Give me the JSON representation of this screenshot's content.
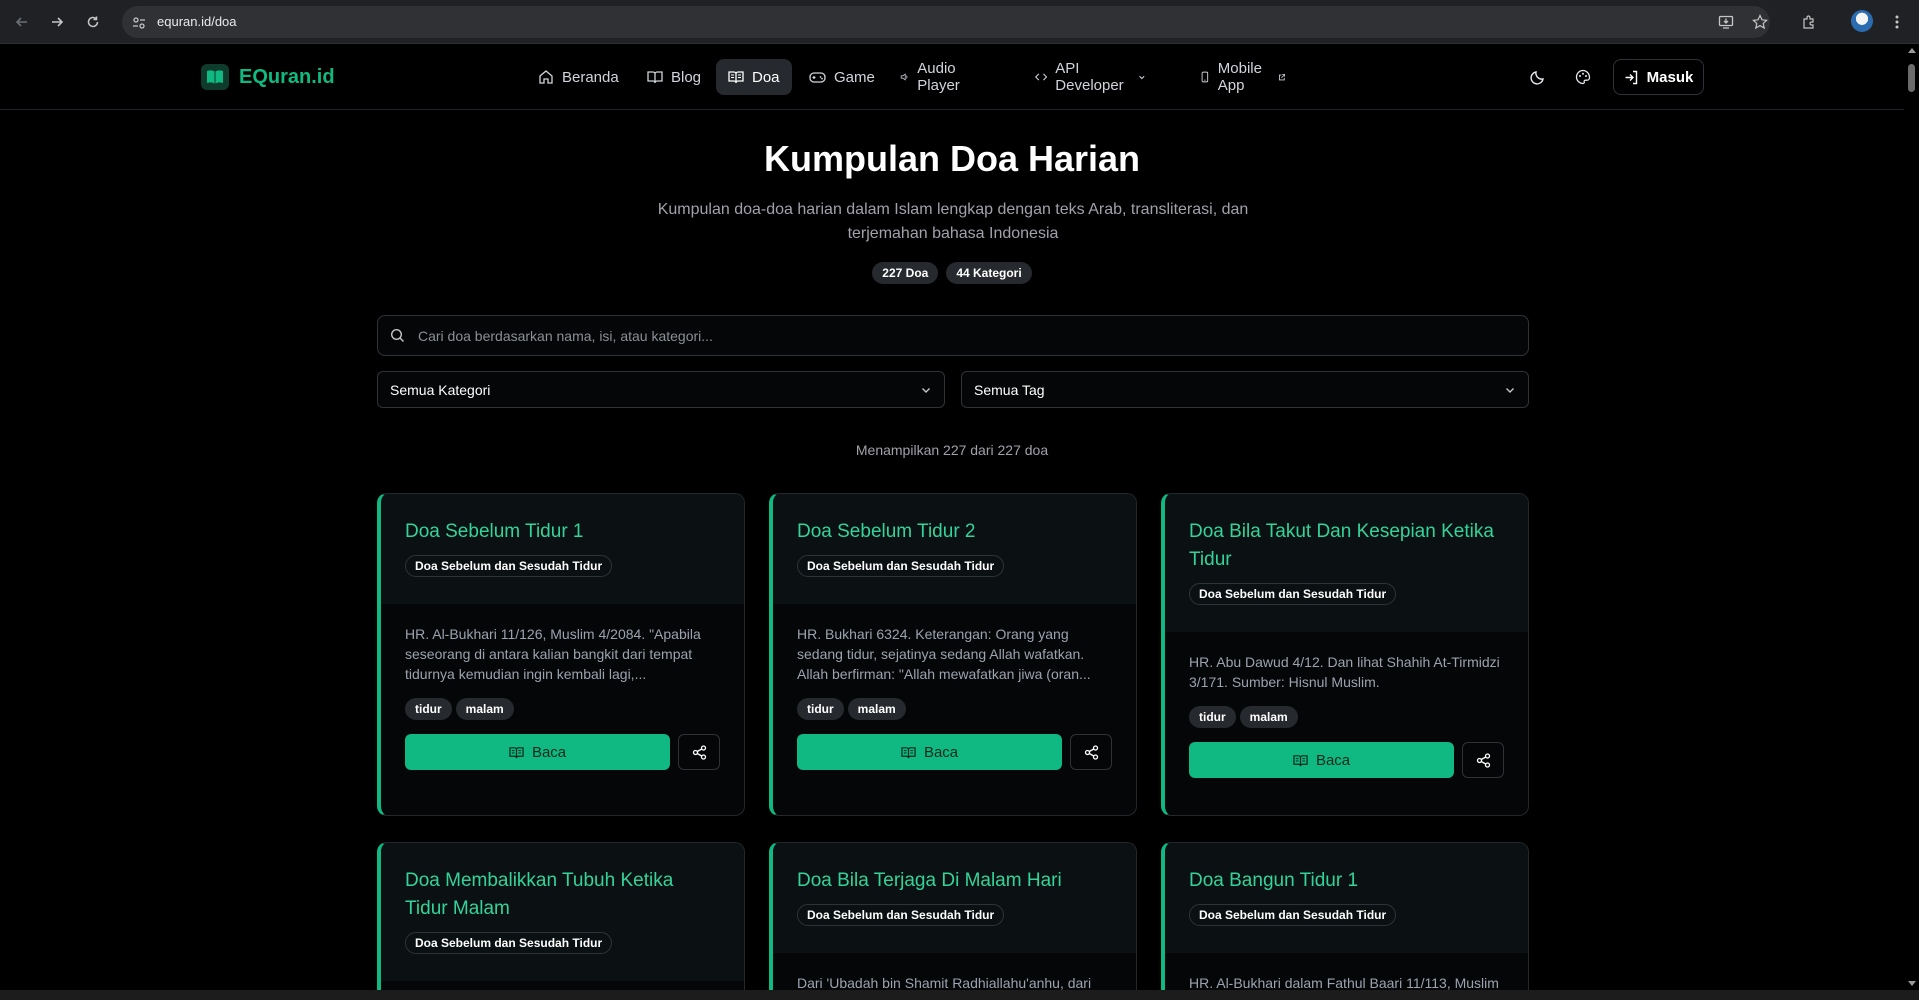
{
  "browser": {
    "url": "equran.id/doa"
  },
  "site": {
    "logo_text": "EQuran.id",
    "accent": "#10b981",
    "nav": [
      {
        "label": "Beranda",
        "icon": "home-icon"
      },
      {
        "label": "Blog",
        "icon": "book-open-icon"
      },
      {
        "label": "Doa",
        "icon": "book-open-icon"
      },
      {
        "label": "Game",
        "icon": "gamepad-icon"
      },
      {
        "label": "Audio Player",
        "icon": "speaker-icon"
      },
      {
        "label": "API Developer",
        "icon": "code-icon"
      },
      {
        "label": "Mobile App",
        "icon": "smartphone-icon"
      }
    ],
    "active_nav": "Doa",
    "login_label": "Masuk"
  },
  "hero": {
    "title": "Kumpulan Doa Harian",
    "subtitle": "Kumpulan doa-doa harian dalam Islam lengkap dengan teks Arab, transliterasi, dan terjemahan bahasa Indonesia",
    "stats": [
      "227 Doa",
      "44 Kategori"
    ]
  },
  "search": {
    "placeholder": "Cari doa berdasarkan nama, isi, atau kategori..."
  },
  "filters": {
    "category": "Semua Kategori",
    "tag": "Semua Tag"
  },
  "result_count": "Menampilkan 227 dari 227 doa",
  "card_labels": {
    "read": "Baca"
  },
  "cards": [
    {
      "title": "Doa Sebelum Tidur 1",
      "category": "Doa Sebelum dan Sesudah Tidur",
      "desc": "HR. Al-Bukhari 11/126, Muslim 4/2084. \"Apabila seseorang di antara kalian bangkit dari tempat tidurnya kemudian ingin kembali lagi,...",
      "tags": [
        "tidur",
        "malam"
      ]
    },
    {
      "title": "Doa Sebelum Tidur 2",
      "category": "Doa Sebelum dan Sesudah Tidur",
      "desc": "HR. Bukhari 6324. Keterangan: Orang yang sedang tidur, sejatinya sedang Allah wafatkan. Allah berfirman: \"Allah mewafatkan jiwa (oran...",
      "tags": [
        "tidur",
        "malam"
      ]
    },
    {
      "title": "Doa Bila Takut Dan Kesepian Ketika Tidur",
      "category": "Doa Sebelum dan Sesudah Tidur",
      "desc": "HR. Abu Dawud 4/12. Dan lihat Shahih At-Tirmidzi 3/171. Sumber: Hisnul Muslim.",
      "tags": [
        "tidur",
        "malam"
      ]
    },
    {
      "title": "Doa Membalikkan Tubuh Ketika Tidur Malam",
      "category": "Doa Sebelum dan Sesudah Tidur",
      "desc": "",
      "tags": []
    },
    {
      "title": "Doa Bila Terjaga Di Malam Hari",
      "category": "Doa Sebelum dan Sesudah Tidur",
      "desc": "Dari 'Ubadah bin Shamit Radhiallahu'anhu, dari",
      "tags": []
    },
    {
      "title": "Doa Bangun Tidur 1",
      "category": "Doa Sebelum dan Sesudah Tidur",
      "desc": "HR. Al-Bukhari dalam Fathul Baari 11/113, Muslim",
      "tags": []
    }
  ]
}
